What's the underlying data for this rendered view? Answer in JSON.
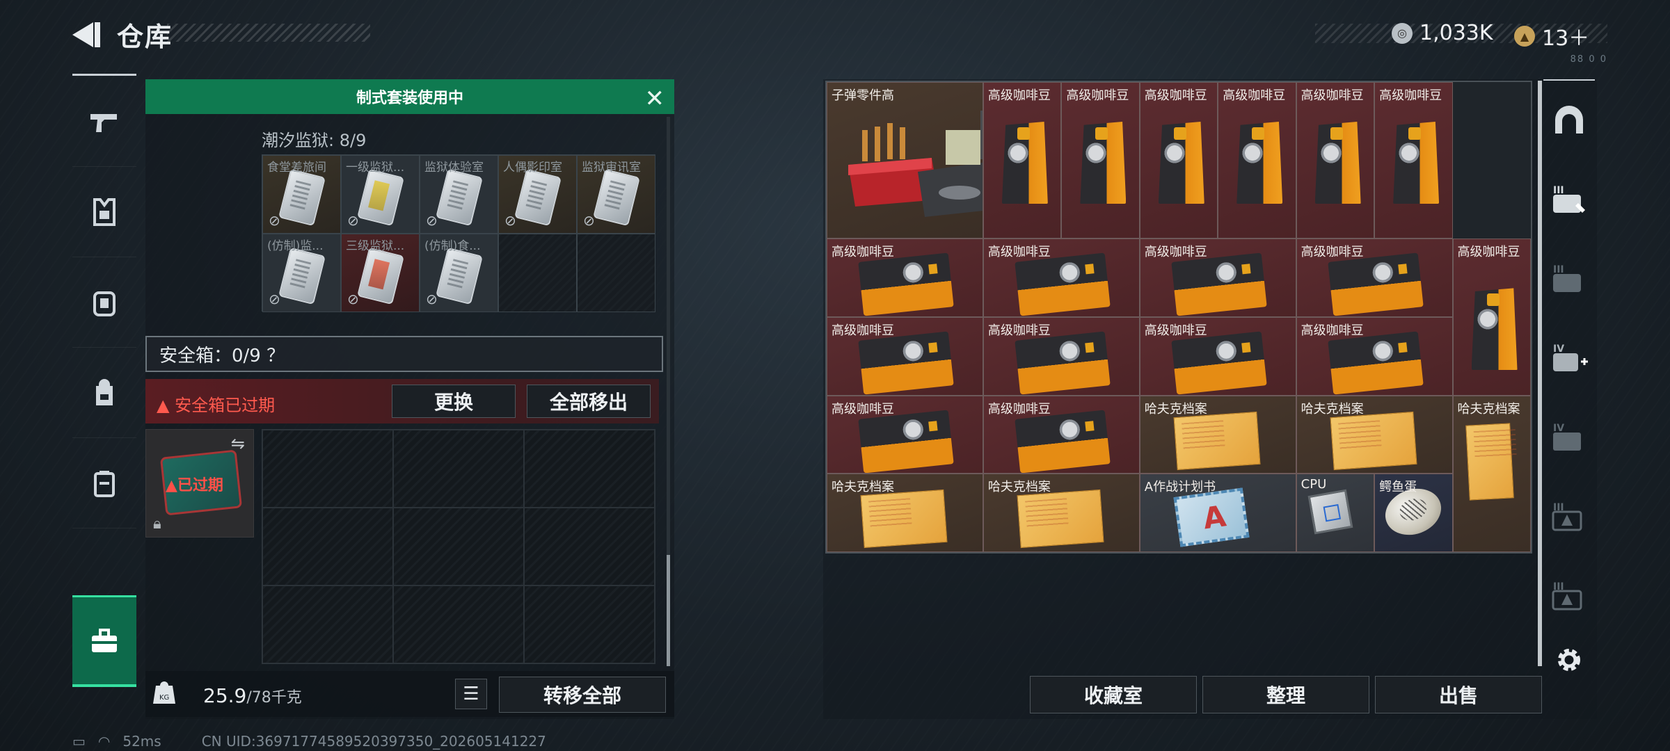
{
  "header": {
    "title": "仓库",
    "currency_main": "1,033K",
    "currency_secondary": "13＋",
    "corner_text": "88 0 0"
  },
  "left_nav": {
    "items": [
      "weapon",
      "armor",
      "backpack-vest",
      "backpack",
      "vest",
      "toolbox"
    ]
  },
  "left_panel": {
    "banner": "制式套装使用中",
    "region_label": "潮汐监狱: 8/9",
    "keycards": [
      {
        "name": "食堂差旅间",
        "style": "orange",
        "color": "white"
      },
      {
        "name": "一级监狱...",
        "style": "dark",
        "color": "yellow"
      },
      {
        "name": "监狱体验室",
        "style": "dark",
        "color": "white"
      },
      {
        "name": "人偶影印室",
        "style": "orange",
        "color": "white"
      },
      {
        "name": "监狱审讯室",
        "style": "orange",
        "color": "white"
      },
      {
        "name": "(仿制)监...",
        "style": "dark",
        "color": "white"
      },
      {
        "name": "三级监狱...",
        "style": "red",
        "color": "red"
      },
      {
        "name": "(仿制)食...",
        "style": "dark",
        "color": "white"
      },
      {
        "name": "",
        "style": "empty",
        "color": ""
      },
      {
        "name": "",
        "style": "empty",
        "color": ""
      }
    ],
    "safe_label": "安全箱：0/9 ？",
    "safe_alert": "安全箱已过期",
    "replace_button": "更换",
    "move_all_out_button": "全部移出",
    "expired_badge": "已过期",
    "weight_value": "25.9",
    "weight_max": "/78千克",
    "transfer_all_button": "转移全部"
  },
  "stash": {
    "items": [
      {
        "name": "子弹零件高",
        "type": "ammo",
        "bg": "brown"
      },
      {
        "name": "高级咖啡豆",
        "type": "bag"
      },
      {
        "name": "高级咖啡豆",
        "type": "bag"
      },
      {
        "name": "高级咖啡豆",
        "type": "bag"
      },
      {
        "name": "高级咖啡豆",
        "type": "bag"
      },
      {
        "name": "高级咖啡豆",
        "type": "bag"
      },
      {
        "name": "高级咖啡豆",
        "type": "bag"
      },
      {
        "name": "高级咖啡豆",
        "type": "flat"
      },
      {
        "name": "高级咖啡豆",
        "type": "flat"
      },
      {
        "name": "高级咖啡豆",
        "type": "flat"
      },
      {
        "name": "高级咖啡豆",
        "type": "flat"
      },
      {
        "name": "高级咖啡豆",
        "type": "bag"
      },
      {
        "name": "高级咖啡豆",
        "type": "flat"
      },
      {
        "name": "高级咖啡豆",
        "type": "flat"
      },
      {
        "name": "高级咖啡豆",
        "type": "flat"
      },
      {
        "name": "高级咖啡豆",
        "type": "flat"
      },
      {
        "name": "高级咖啡豆",
        "type": "flat"
      },
      {
        "name": "高级咖啡豆",
        "type": "flat"
      },
      {
        "name": "哈夫克档案",
        "type": "folder"
      },
      {
        "name": "哈夫克档案",
        "type": "folder"
      },
      {
        "name": "哈夫克档案",
        "type": "folderv"
      },
      {
        "name": "哈夫克档案",
        "type": "folder"
      },
      {
        "name": "哈夫克档案",
        "type": "folder"
      },
      {
        "name": "A作战计划书",
        "type": "plan"
      },
      {
        "name": "CPU",
        "type": "cpu"
      },
      {
        "name": "鳄鱼蛋",
        "type": "egg"
      }
    ],
    "collection_button": "收藏室",
    "organize_button": "整理",
    "sell_button": "出售"
  },
  "right_nav": {
    "labels": [
      "",
      "III",
      "III",
      "IV",
      "IV",
      "III",
      "III"
    ]
  },
  "status_bar": {
    "latency": "52ms",
    "uid": "CN UID:36971774589520397350_202605141227"
  },
  "colors": {
    "accent": "#0f7a50",
    "active": "#36e0a0",
    "alert": "#ff5a4e",
    "item_red": "#5c2c30"
  }
}
